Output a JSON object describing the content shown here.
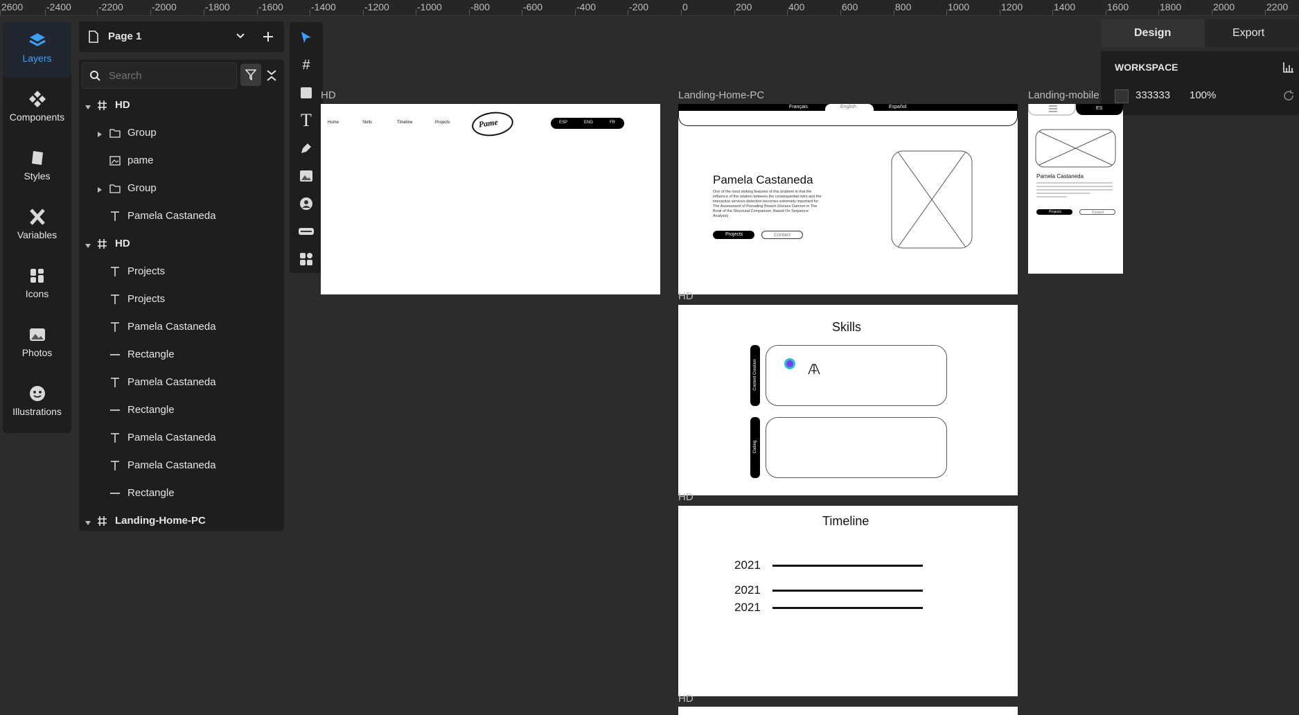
{
  "ruler": {
    "labels": [
      "2600",
      "-2400",
      "-2200",
      "-2000",
      "-1800",
      "-1600",
      "-1400",
      "-1200",
      "-1000",
      "-800",
      "-600",
      "-400",
      "-200",
      "0",
      "200",
      "400",
      "600",
      "800",
      "1000",
      "1200",
      "1400",
      "1600",
      "1800",
      "2000",
      "2200"
    ]
  },
  "leftnav": {
    "items": [
      {
        "label": "Layers",
        "icon": "layers-icon"
      },
      {
        "label": "Components",
        "icon": "components-icon"
      },
      {
        "label": "Styles",
        "icon": "styles-icon"
      },
      {
        "label": "Variables",
        "icon": "variables-icon"
      },
      {
        "label": "Icons",
        "icon": "icons-icon"
      },
      {
        "label": "Photos",
        "icon": "photos-icon"
      },
      {
        "label": "Illustrations",
        "icon": "illustrations-icon"
      }
    ]
  },
  "pagebar": {
    "page_name": "Page 1"
  },
  "search": {
    "placeholder": "Search"
  },
  "layers": [
    {
      "label": "HD",
      "type": "frame"
    },
    {
      "label": "Group",
      "type": "group"
    },
    {
      "label": "pame",
      "type": "image"
    },
    {
      "label": "Group",
      "type": "group"
    },
    {
      "label": "Pamela Castaneda",
      "type": "text"
    },
    {
      "label": "HD",
      "type": "frame"
    },
    {
      "label": "Projects",
      "type": "text"
    },
    {
      "label": "Projects",
      "type": "text"
    },
    {
      "label": "Pamela Castaneda",
      "type": "text"
    },
    {
      "label": "Rectangle",
      "type": "line"
    },
    {
      "label": "Pamela Castaneda",
      "type": "text"
    },
    {
      "label": "Rectangle",
      "type": "line"
    },
    {
      "label": "Pamela Castaneda",
      "type": "text"
    },
    {
      "label": "Pamela Castaneda",
      "type": "text"
    },
    {
      "label": "Rectangle",
      "type": "line"
    },
    {
      "label": "Landing-Home-PC",
      "type": "frame"
    }
  ],
  "right_panel": {
    "tabs": [
      "Design",
      "Export"
    ],
    "section_title": "WORKSPACE",
    "color_hex": "333333",
    "opacity": "100%"
  },
  "canvas": {
    "frame1": {
      "label": "HD",
      "nav": [
        "Home",
        "Skills",
        "Timeline",
        "Projects"
      ],
      "logo": "Pame",
      "langs": [
        "ESP",
        "ENG",
        "FR"
      ]
    },
    "frame2": {
      "label": "Landing-Home-PC",
      "langs": [
        "Français",
        "English",
        "Español"
      ],
      "name": "Pamela Castaneda",
      "body": "One of the most striking features of this problem is that the influence of the relation between the consequential risks and the interactive services detection becomes extremely important for The Assessment of Prevailing Breach (Horace Damron in The Book of the Structural Comparison. Based On Sequence Analysis)",
      "btn1": "Projects",
      "btn2": "Contact"
    },
    "frame3": {
      "label": "Landing-mobile",
      "name": "Pamela Castaneda",
      "btn1": "Projects",
      "btn2": "Contact",
      "lang": "ES"
    },
    "frame4": {
      "label": "HD",
      "title": "Skills",
      "tab1": "Content Creation",
      "tab2": "Coding"
    },
    "frame5": {
      "label": "HD",
      "title": "Timeline",
      "years": [
        "2021",
        "2021",
        "2021"
      ]
    },
    "frame6": {
      "label": "HD"
    }
  },
  "colors": {
    "accent": "#3aa0ff",
    "panel": "#1e1e1e",
    "canvas": "#2c2c2c"
  }
}
